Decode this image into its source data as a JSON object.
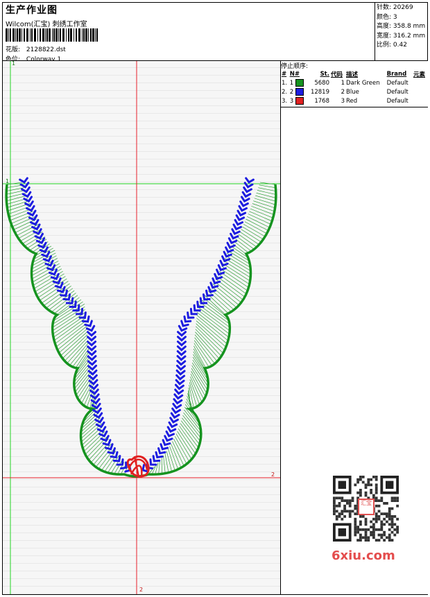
{
  "header": {
    "title": "生产作业图",
    "company": "Wilcom(汇宝) 刺绣工作室",
    "design_label": "花版:",
    "design_value": "2128822.dst",
    "colorway_label": "色位:",
    "colorway_value": "Colorway 1"
  },
  "stats": {
    "stitches_label": "针数:",
    "stitches_value": "20269",
    "colors_label": "颜色:",
    "colors_value": "3",
    "height_label": "高度:",
    "height_value": "358.8 mm",
    "width_label": "宽度:",
    "width_value": "316.2 mm",
    "ratio_label": "比例:",
    "ratio_value": "0.42"
  },
  "sequence": {
    "title": "停止顺序:",
    "columns": [
      "#",
      "N#",
      "St.",
      "代码",
      "描述",
      "Brand",
      "元素"
    ],
    "rows": [
      {
        "idx": "1.",
        "n": "1",
        "color": "#15931f",
        "st": "5680",
        "code": "1",
        "desc": "Dark Green",
        "brand": "Default"
      },
      {
        "idx": "2.",
        "n": "2",
        "color": "#1d1de0",
        "st": "12819",
        "code": "2",
        "desc": "Blue",
        "brand": "Default"
      },
      {
        "idx": "3.",
        "n": "3",
        "color": "#e02020",
        "st": "1768",
        "code": "3",
        "desc": "Red",
        "brand": "Default"
      }
    ]
  },
  "canvas": {
    "marker_1_top": "1",
    "marker_1_left": "1",
    "marker_2_right": "2",
    "marker_2_bottom": "2",
    "axis_color": "#e8202a",
    "guide_color": "#22d422"
  },
  "watermark": {
    "text": "6xiu.com",
    "seal": "汇宝"
  }
}
